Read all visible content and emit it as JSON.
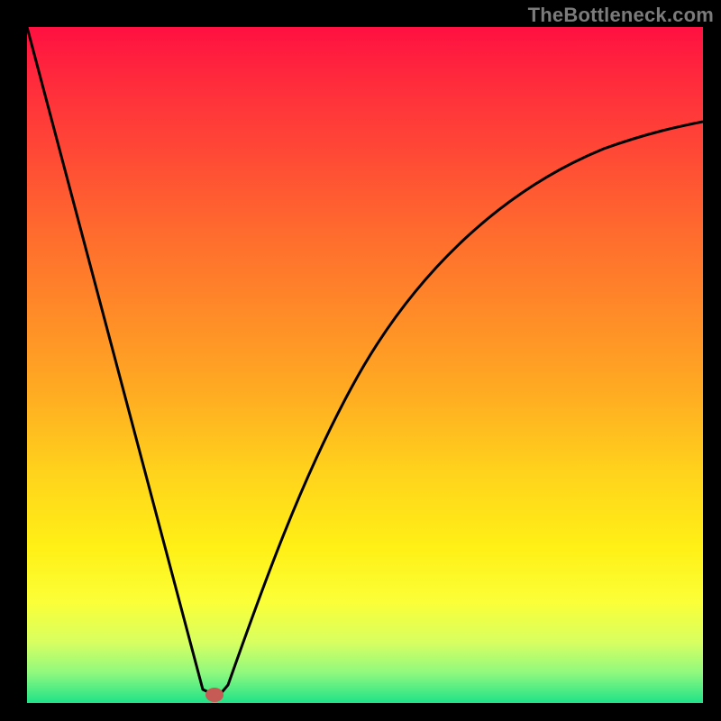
{
  "attribution": "TheBottleneck.com",
  "chart_data": {
    "type": "line",
    "title": "",
    "xlabel": "",
    "ylabel": "",
    "xlim": [
      0,
      100
    ],
    "ylim": [
      0,
      100
    ],
    "series": [
      {
        "name": "left-descending-branch",
        "x": [
          0,
          27
        ],
        "values": [
          100,
          0
        ]
      },
      {
        "name": "right-ascending-branch",
        "x": [
          27,
          29,
          33,
          38,
          44,
          51,
          60,
          70,
          82,
          100
        ],
        "values": [
          0,
          8,
          22,
          38,
          52,
          63,
          72,
          78,
          82,
          86
        ]
      }
    ],
    "annotations": [
      {
        "name": "min-marker",
        "x": 27,
        "y": 0,
        "color": "#c65a55"
      }
    ],
    "background": {
      "type": "vertical-gradient",
      "note": "gradient from red at top to green at bottom",
      "stops": [
        {
          "pos": 0,
          "color": "#ff1041"
        },
        {
          "pos": 0.5,
          "color": "#ffab22"
        },
        {
          "pos": 0.85,
          "color": "#fbff37"
        },
        {
          "pos": 1,
          "color": "#1fe288"
        }
      ]
    }
  }
}
